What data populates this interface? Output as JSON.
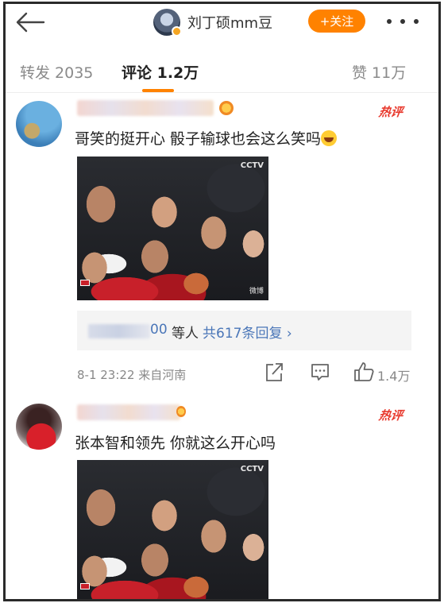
{
  "header": {
    "author_name": "刘丁硕mm豆",
    "follow_label": "+关注"
  },
  "tabs": {
    "forward": "转发 2035",
    "comments": "评论 1.2万",
    "likes": "赞 11万"
  },
  "comments": [
    {
      "hot_tag": "热评",
      "text": "哥笑的挺开心 骰子输球也会这么笑吗",
      "emoji_icon": "laughing-tears-emoji",
      "image": {
        "broadcaster": "CCTV",
        "watermark": "微博"
      },
      "replies": {
        "user_tail": "00",
        "suffix": "等人",
        "link": "共617条回复 ›"
      },
      "timestamp": "8-1 23:22",
      "location": "来自河南",
      "like_count": "1.4万"
    },
    {
      "hot_tag": "热评",
      "text": "张本智和领先 你就这么开心吗",
      "image": {
        "broadcaster": "CCTV"
      }
    }
  ],
  "colors": {
    "accent": "#ff8200",
    "link": "#4a76b8",
    "hot": "#e8382c"
  }
}
